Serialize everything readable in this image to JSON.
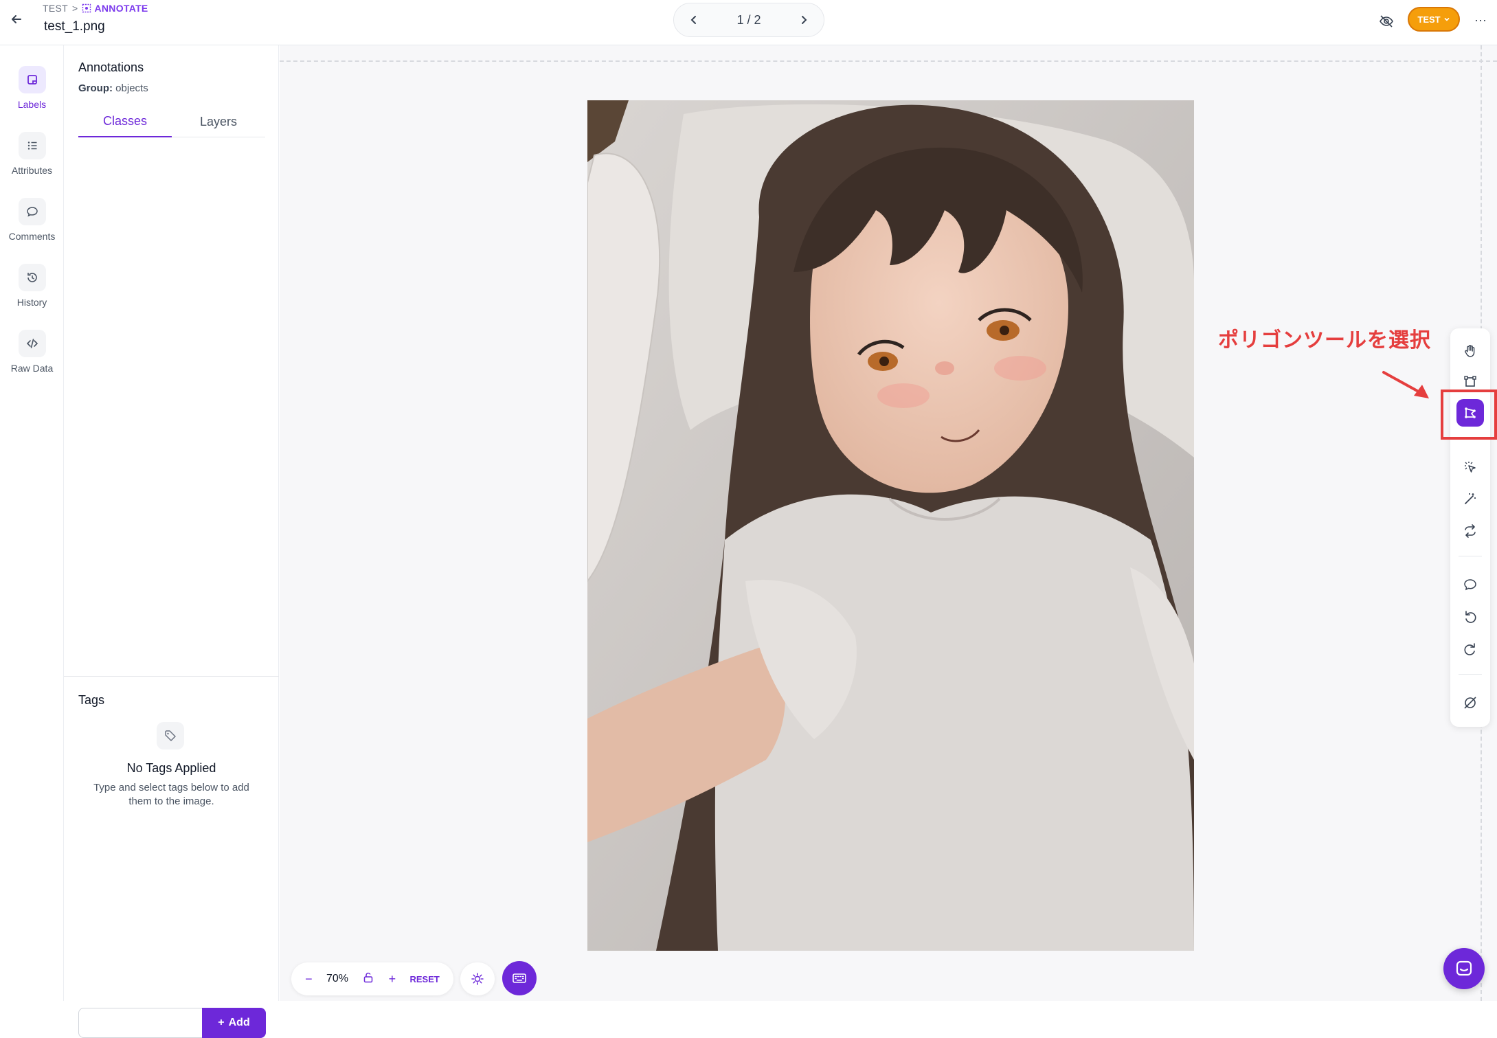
{
  "header": {
    "breadcrumb_project": "TEST",
    "breadcrumb_sep": ">",
    "breadcrumb_current": "ANNOTATE",
    "filename": "test_1.png",
    "pager_text": "1 / 2",
    "user_badge": "TEST",
    "more_label": "···"
  },
  "leftnav": {
    "items": [
      {
        "label": "Labels",
        "icon": "labels-icon",
        "active": true
      },
      {
        "label": "Attributes",
        "icon": "list-icon",
        "active": false
      },
      {
        "label": "Comments",
        "icon": "comment-icon",
        "active": false
      },
      {
        "label": "History",
        "icon": "history-icon",
        "active": false
      },
      {
        "label": "Raw Data",
        "icon": "code-icon",
        "active": false
      }
    ]
  },
  "panel": {
    "title": "Annotations",
    "group_label": "Group:",
    "group_value": "objects",
    "tabs": [
      {
        "label": "Classes",
        "active": true
      },
      {
        "label": "Layers",
        "active": false
      }
    ],
    "tags": {
      "title": "Tags",
      "empty_title": "No Tags Applied",
      "empty_desc": "Type and select tags below to add them to the image.",
      "input_value": "",
      "input_placeholder": "",
      "add_label": "Add"
    }
  },
  "toolbar": {
    "tools": [
      "hand-icon",
      "bounding-box-icon",
      "polygon-icon",
      "smart-select-icon",
      "magic-wand-icon",
      "repeat-icon",
      "comment-icon",
      "undo-icon",
      "redo-icon",
      "hide-icon"
    ],
    "active_tool": "polygon-icon"
  },
  "annotation_note": {
    "text": "ポリゴンツールを選択",
    "color": "#e53e3e"
  },
  "zoom": {
    "minus": "−",
    "value": "70%",
    "plus": "+",
    "reset": "RESET"
  },
  "colors": {
    "accent": "#6d28d9",
    "badge": "#f59e0b",
    "highlight": "#e53e3e"
  }
}
